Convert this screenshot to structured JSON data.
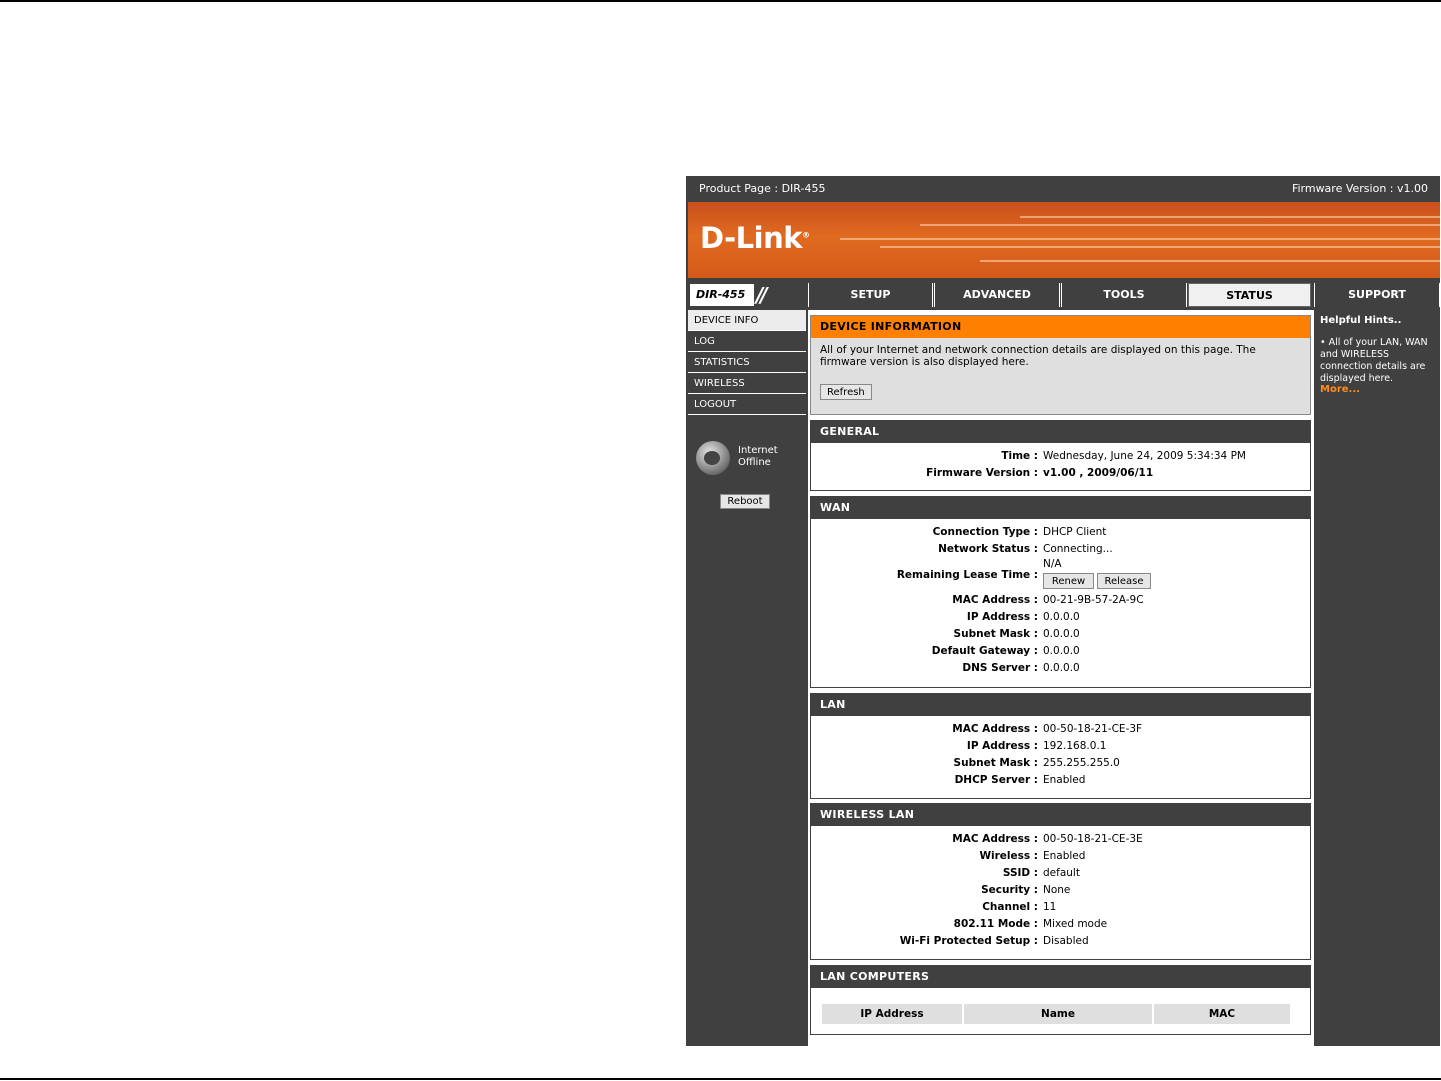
{
  "top_bar": {
    "product_label": "Product Page :  DIR-455",
    "firmware_label": "Firmware Version : v1.00"
  },
  "brand": {
    "logo": "D-Link",
    "model": "DIR-455",
    "slashes": "//"
  },
  "nav_tabs": [
    {
      "label": "SETUP"
    },
    {
      "label": "ADVANCED"
    },
    {
      "label": "TOOLS"
    },
    {
      "label": "STATUS",
      "active": true
    },
    {
      "label": "SUPPORT"
    }
  ],
  "sidebar": {
    "items": [
      {
        "label": "DEVICE INFO",
        "active": true
      },
      {
        "label": "LOG"
      },
      {
        "label": "STATISTICS"
      },
      {
        "label": "WIRELESS"
      },
      {
        "label": "LOGOUT"
      }
    ],
    "internet_status_line1": "Internet",
    "internet_status_line2": "Offline",
    "reboot_label": "Reboot"
  },
  "device_info": {
    "title": "DEVICE INFORMATION",
    "description": "All of your Internet and network connection details are displayed on this page. The firmware version is also displayed here.",
    "refresh_label": "Refresh"
  },
  "general": {
    "title": "GENERAL",
    "time_label": "Time :",
    "time_value": "Wednesday, June 24, 2009 5:34:34 PM",
    "fw_label": "Firmware Version :",
    "fw_value": "v1.00 , 2009/06/11"
  },
  "wan": {
    "title": "WAN",
    "connection_type_label": "Connection Type :",
    "connection_type": "DHCP Client",
    "network_status_label": "Network Status :",
    "network_status": "Connecting...",
    "lease_label": "Remaining Lease Time :",
    "lease_value": "N/A",
    "renew_label": "Renew",
    "release_label": "Release",
    "mac_label": "MAC Address :",
    "mac": "00-21-9B-57-2A-9C",
    "ip_label": "IP Address :",
    "ip": "0.0.0.0",
    "mask_label": "Subnet Mask :",
    "mask": "0.0.0.0",
    "gw_label": "Default Gateway :",
    "gw": "0.0.0.0",
    "dns_label": "DNS Server :",
    "dns": "0.0.0.0"
  },
  "lan": {
    "title": "LAN",
    "mac_label": "MAC Address :",
    "mac": "00-50-18-21-CE-3F",
    "ip_label": "IP Address :",
    "ip": "192.168.0.1",
    "mask_label": "Subnet Mask :",
    "mask": "255.255.255.0",
    "dhcp_label": "DHCP Server :",
    "dhcp": "Enabled"
  },
  "wireless_lan": {
    "title": "WIRELESS LAN",
    "mac_label": "MAC Address :",
    "mac": "00-50-18-21-CE-3E",
    "wireless_label": "Wireless :",
    "wireless": "Enabled",
    "ssid_label": "SSID :",
    "ssid": "default",
    "security_label": "Security :",
    "security": "None",
    "channel_label": "Channel :",
    "channel": "11",
    "mode_label": "802.11 Mode :",
    "mode": "Mixed mode",
    "wps_label": "Wi-Fi Protected Setup :",
    "wps": "Disabled"
  },
  "lan_computers": {
    "title": "LAN COMPUTERS",
    "columns": [
      "IP Address",
      "Name",
      "MAC"
    ]
  },
  "help": {
    "title": "Helpful Hints..",
    "body": "•  All of your LAN, WAN and WIRELESS connection details are displayed here.",
    "more": "More..."
  },
  "colors": {
    "dark": "#404040",
    "orange": "#ff7f00",
    "light": "#dfdfdf"
  }
}
